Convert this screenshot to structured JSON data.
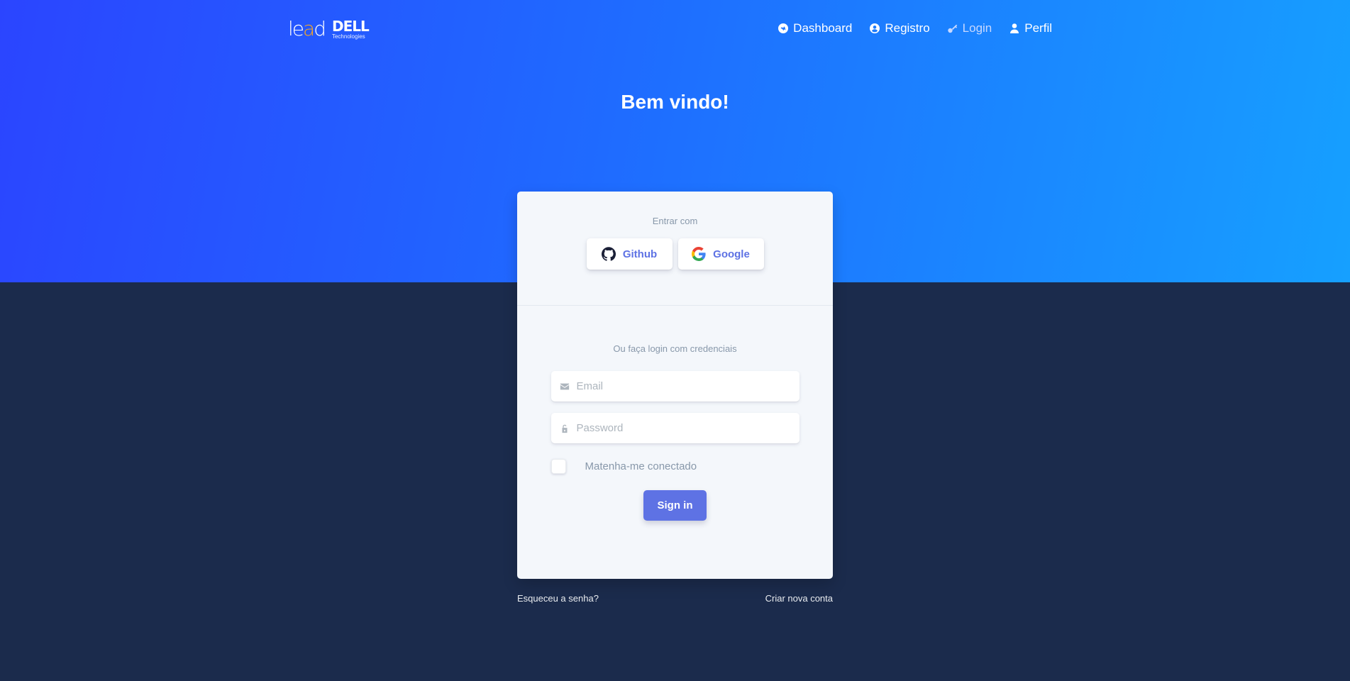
{
  "brand": {
    "lead_text": "lead",
    "dell_text": "DELL",
    "dell_sub": "Technologies"
  },
  "nav": {
    "dashboard": "Dashboard",
    "register": "Registro",
    "login": "Login",
    "profile": "Perfil"
  },
  "hero": {
    "title": "Bem vindo!"
  },
  "card": {
    "social_caption": "Entrar com",
    "github_label": "Github",
    "google_label": "Google",
    "credentials_caption": "Ou faça login com credenciais",
    "email_placeholder": "Email",
    "password_placeholder": "Password",
    "remember_label": "Matenha-me conectado",
    "signin_label": "Sign in"
  },
  "footer": {
    "forgot": "Esqueceu a senha?",
    "create": "Criar nova conta"
  },
  "icons": {
    "dashboard": "tv-icon",
    "register": "user-circle-icon",
    "login": "key-icon",
    "profile": "user-icon",
    "github": "github-icon",
    "google": "google-icon",
    "email": "envelope-icon",
    "password": "lock-icon"
  },
  "colors": {
    "hero_start": "#2b45ff",
    "hero_end": "#16a0ff",
    "background": "#1b2b4c",
    "accent": "#5e72e4",
    "card": "#f4f7fb"
  }
}
